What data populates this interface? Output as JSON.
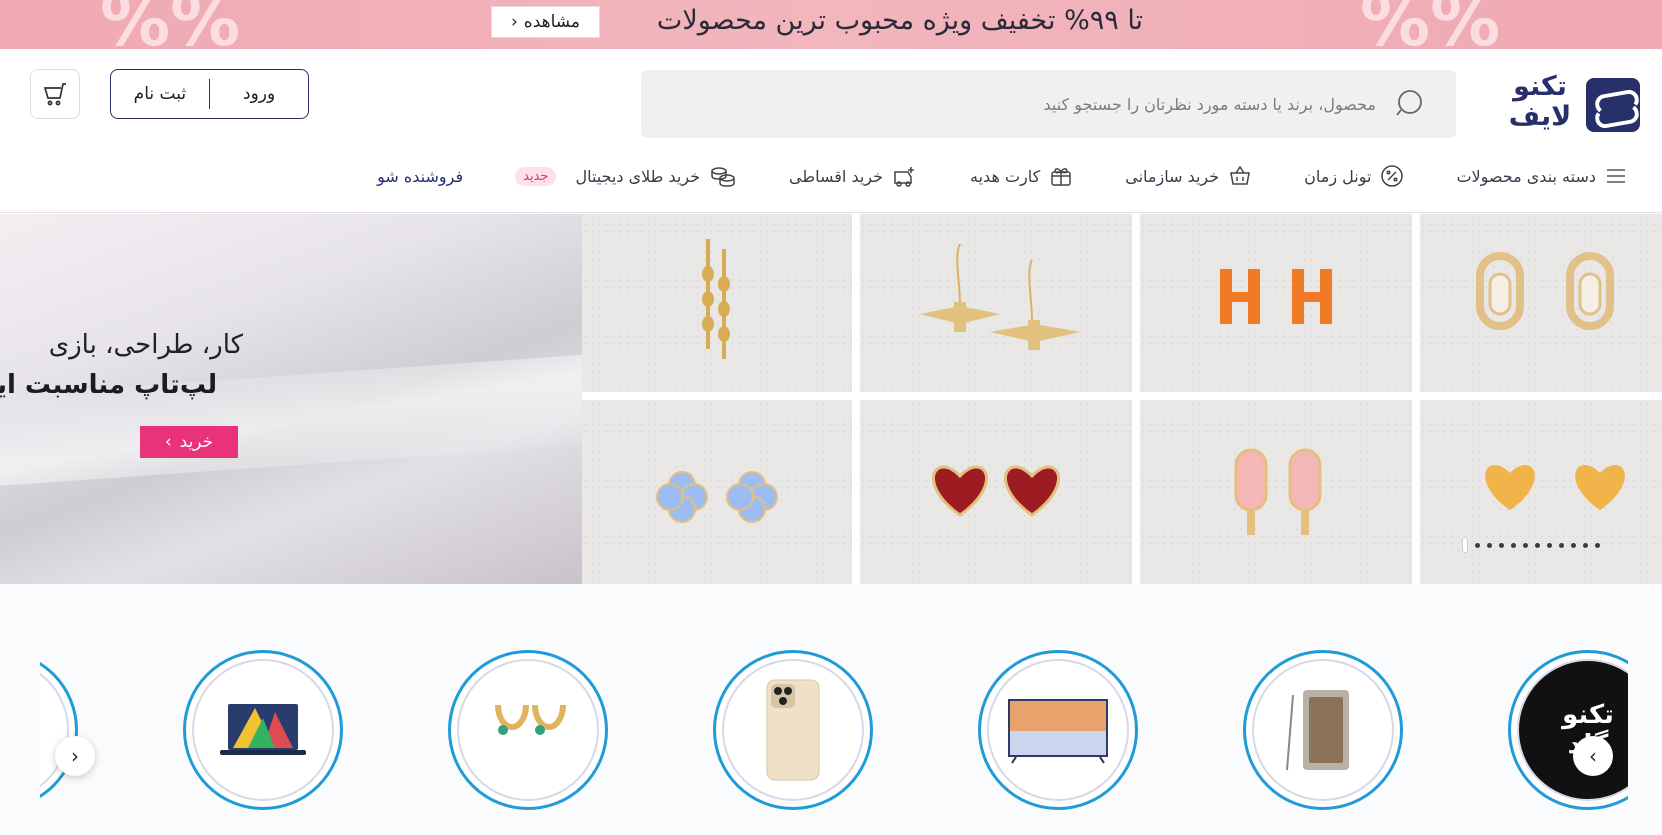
{
  "promo": {
    "title": "تا ۹۹% تخفیف ویژه محبوب ترین محصولات",
    "button_label": "مشاهده",
    "background_color": "#f0a9b1"
  },
  "header": {
    "logo_text": "تکنو لایف",
    "search": {
      "placeholder": "محصول، برند یا دسته مورد نظرتان را جستجو کنید"
    },
    "auth": {
      "login_label": "ورود",
      "signup_label": "ثبت نام"
    },
    "brand_color": "#27306b"
  },
  "nav": {
    "categories_label": "دسته بندی محصولات",
    "items": [
      {
        "label": "تونل زمان",
        "icon": "percent-badge-icon"
      },
      {
        "label": "خرید سازمانی",
        "icon": "basket-icon"
      },
      {
        "label": "کارت هدیه",
        "icon": "gift-icon"
      },
      {
        "label": "خرید اقساطی",
        "icon": "installment-icon"
      },
      {
        "label": "خرید طلای دیجیتال",
        "icon": "coins-icon",
        "badge": "جدید"
      }
    ],
    "seller_label": "فروشنده شو"
  },
  "hero": {
    "line1": "کار، طراحی، بازی",
    "line2": "لپ‌تاپ مناسبت اینجاست",
    "buy_label": "خرید",
    "accent_color": "#e8337b"
  },
  "carousel": {
    "total_slides": 12,
    "active_slide": 12
  },
  "categories": {
    "items": [
      {
        "name": "techno-gold"
      },
      {
        "name": "mobile"
      },
      {
        "name": "tv"
      },
      {
        "name": "iphone"
      },
      {
        "name": "earrings"
      },
      {
        "name": "laptop"
      }
    ],
    "logo_lines": [
      "تکنو",
      "گلد"
    ]
  }
}
